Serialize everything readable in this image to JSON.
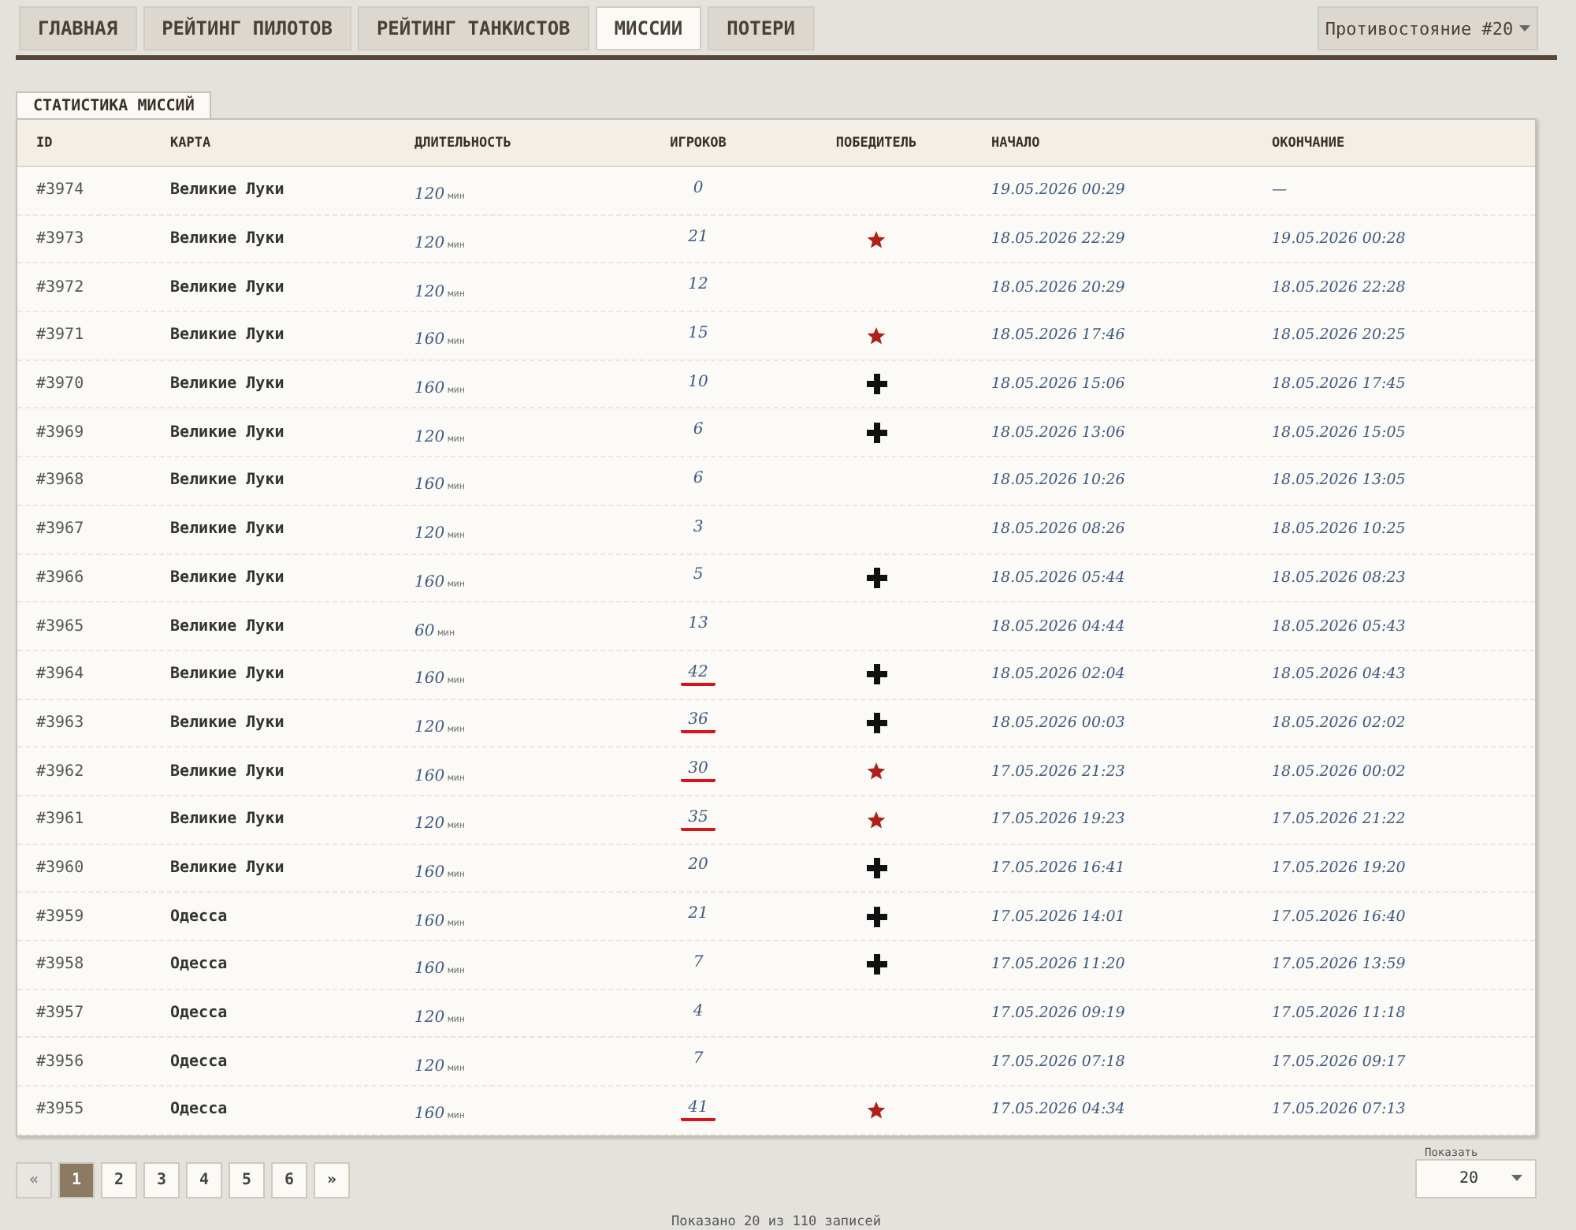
{
  "nav": {
    "tabs": [
      {
        "label": "ГЛАВНАЯ",
        "selected": false
      },
      {
        "label": "РЕЙТИНГ ПИЛОТОВ",
        "selected": false
      },
      {
        "label": "РЕЙТИНГ ТАНКИСТОВ",
        "selected": false
      },
      {
        "label": "МИССИИ",
        "selected": true
      },
      {
        "label": "ПОТЕРИ",
        "selected": false
      }
    ],
    "season_dropdown": {
      "value": "Противостояние #20"
    }
  },
  "panel": {
    "title": "СТАТИСТИКА МИССИЙ",
    "table": {
      "columns": [
        "ID",
        "КАРТА",
        "ДЛИТЕЛЬНОСТЬ",
        "ИГРОКОВ",
        "ПОБЕДИТЕЛЬ",
        "НАЧАЛО",
        "ОКОНЧАНИЕ"
      ],
      "rows": [
        {
          "id": "#3974",
          "map": "Великие Луки",
          "duration": "120",
          "unit": "мин",
          "players": "0",
          "underlined": false,
          "start": "19.05.2026 00:29",
          "end": "—"
        },
        {
          "id": "#3973",
          "map": "Великие Луки",
          "duration": "120",
          "unit": "мин",
          "players": "21",
          "underlined": false,
          "winner": {
            "kind": "star"
          },
          "start": "18.05.2026 22:29",
          "end": "19.05.2026 00:28"
        },
        {
          "id": "#3972",
          "map": "Великие Луки",
          "duration": "120",
          "unit": "мин",
          "players": "12",
          "underlined": false,
          "start": "18.05.2026 20:29",
          "end": "18.05.2026 22:28"
        },
        {
          "id": "#3971",
          "map": "Великие Луки",
          "duration": "160",
          "unit": "мин",
          "players": "15",
          "underlined": false,
          "winner": {
            "kind": "star"
          },
          "start": "18.05.2026 17:46",
          "end": "18.05.2026 20:25"
        },
        {
          "id": "#3970",
          "map": "Великие Луки",
          "duration": "160",
          "unit": "мин",
          "players": "10",
          "underlined": false,
          "winner": {
            "kind": "cross"
          },
          "start": "18.05.2026 15:06",
          "end": "18.05.2026 17:45"
        },
        {
          "id": "#3969",
          "map": "Великие Луки",
          "duration": "120",
          "unit": "мин",
          "players": "6",
          "underlined": false,
          "winner": {
            "kind": "cross"
          },
          "start": "18.05.2026 13:06",
          "end": "18.05.2026 15:05"
        },
        {
          "id": "#3968",
          "map": "Великие Луки",
          "duration": "160",
          "unit": "мин",
          "players": "6",
          "underlined": false,
          "start": "18.05.2026 10:26",
          "end": "18.05.2026 13:05"
        },
        {
          "id": "#3967",
          "map": "Великие Луки",
          "duration": "120",
          "unit": "мин",
          "players": "3",
          "underlined": false,
          "start": "18.05.2026 08:26",
          "end": "18.05.2026 10:25"
        },
        {
          "id": "#3966",
          "map": "Великие Луки",
          "duration": "160",
          "unit": "мин",
          "players": "5",
          "underlined": false,
          "winner": {
            "kind": "cross"
          },
          "start": "18.05.2026 05:44",
          "end": "18.05.2026 08:23"
        },
        {
          "id": "#3965",
          "map": "Великие Луки",
          "duration": "60",
          "unit": "мин",
          "players": "13",
          "underlined": false,
          "start": "18.05.2026 04:44",
          "end": "18.05.2026 05:43"
        },
        {
          "id": "#3964",
          "map": "Великие Луки",
          "duration": "160",
          "unit": "мин",
          "players": "42",
          "underlined": true,
          "winner": {
            "kind": "cross"
          },
          "start": "18.05.2026 02:04",
          "end": "18.05.2026 04:43"
        },
        {
          "id": "#3963",
          "map": "Великие Луки",
          "duration": "120",
          "unit": "мин",
          "players": "36",
          "underlined": true,
          "winner": {
            "kind": "cross"
          },
          "start": "18.05.2026 00:03",
          "end": "18.05.2026 02:02"
        },
        {
          "id": "#3962",
          "map": "Великие Луки",
          "duration": "160",
          "unit": "мин",
          "players": "30",
          "underlined": true,
          "winner": {
            "kind": "star"
          },
          "start": "17.05.2026 21:23",
          "end": "18.05.2026 00:02"
        },
        {
          "id": "#3961",
          "map": "Великие Луки",
          "duration": "120",
          "unit": "мин",
          "players": "35",
          "underlined": true,
          "winner": {
            "kind": "star"
          },
          "start": "17.05.2026 19:23",
          "end": "17.05.2026 21:22"
        },
        {
          "id": "#3960",
          "map": "Великие Луки",
          "duration": "160",
          "unit": "мин",
          "players": "20",
          "underlined": false,
          "winner": {
            "kind": "cross"
          },
          "start": "17.05.2026 16:41",
          "end": "17.05.2026 19:20"
        },
        {
          "id": "#3959",
          "map": "Одесса",
          "duration": "160",
          "unit": "мин",
          "players": "21",
          "underlined": false,
          "winner": {
            "kind": "cross"
          },
          "start": "17.05.2026 14:01",
          "end": "17.05.2026 16:40"
        },
        {
          "id": "#3958",
          "map": "Одесса",
          "duration": "160",
          "unit": "мин",
          "players": "7",
          "underlined": false,
          "winner": {
            "kind": "cross"
          },
          "start": "17.05.2026 11:20",
          "end": "17.05.2026 13:59"
        },
        {
          "id": "#3957",
          "map": "Одесса",
          "duration": "120",
          "unit": "мин",
          "players": "4",
          "underlined": false,
          "start": "17.05.2026 09:19",
          "end": "17.05.2026 11:18"
        },
        {
          "id": "#3956",
          "map": "Одесса",
          "duration": "120",
          "unit": "мин",
          "players": "7",
          "underlined": false,
          "start": "17.05.2026 07:18",
          "end": "17.05.2026 09:17"
        },
        {
          "id": "#3955",
          "map": "Одесса",
          "duration": "160",
          "unit": "мин",
          "players": "41",
          "underlined": true,
          "winner": {
            "kind": "star"
          },
          "start": "17.05.2026 04:34",
          "end": "17.05.2026 07:13"
        }
      ]
    }
  },
  "pagination": {
    "prev": "«",
    "next": "»",
    "pages": [
      {
        "label": "1",
        "selected": true
      },
      {
        "label": "2",
        "selected": false
      },
      {
        "label": "3",
        "selected": false
      },
      {
        "label": "4",
        "selected": false
      },
      {
        "label": "5",
        "selected": false
      },
      {
        "label": "6",
        "selected": false
      }
    ],
    "page_size": {
      "label": "Показать",
      "value": "20"
    }
  },
  "footer": "Показано 20 из 110 записей"
}
